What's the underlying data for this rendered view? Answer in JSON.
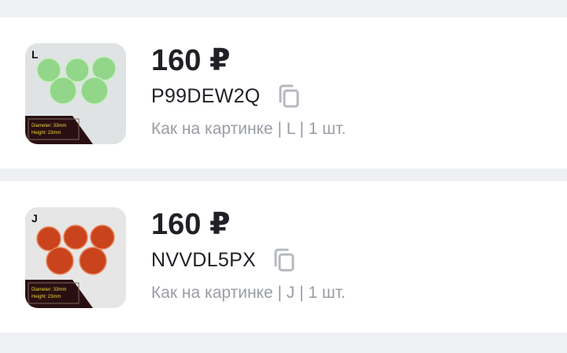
{
  "items": [
    {
      "thumb_letter": "L",
      "thumb_caption_line1": "Diameter: 33mm",
      "thumb_caption_line2": "Height: 23mm",
      "bead_color": "#92d68a",
      "bead_highlight": "#c9efc2",
      "price": "160 ₽",
      "code": "P99DEW2Q",
      "copy_icon": "copy-icon",
      "description": "Как на картинке | L | 1 шт."
    },
    {
      "thumb_letter": "J",
      "thumb_caption_line1": "Diameter: 33mm",
      "thumb_caption_line2": "Height: 23mm",
      "bead_color": "#c9441d",
      "bead_highlight": "#e8835a",
      "price": "160 ₽",
      "code": "NVVDL5PX",
      "copy_icon": "copy-icon",
      "description": "Как на картинке | J | 1 шт."
    }
  ]
}
